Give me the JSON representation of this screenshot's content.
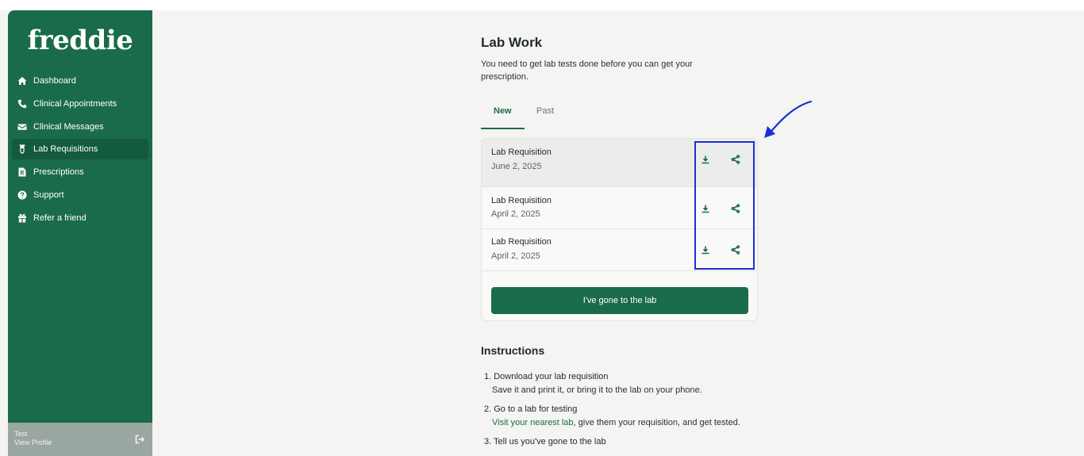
{
  "brand": {
    "logo": "freddie",
    "accent": "#1a6b4a",
    "annotation_color": "#1c2fd6"
  },
  "sidebar": {
    "items": [
      {
        "label": "Dashboard",
        "icon": "home-icon"
      },
      {
        "label": "Clinical Appointments",
        "icon": "phone-icon"
      },
      {
        "label": "Clinical Messages",
        "icon": "envelope-icon"
      },
      {
        "label": "Lab Requisitions",
        "icon": "test-tube-icon",
        "active": true
      },
      {
        "label": "Prescriptions",
        "icon": "prescription-icon"
      },
      {
        "label": "Support",
        "icon": "question-icon"
      },
      {
        "label": "Refer a friend",
        "icon": "gift-icon"
      }
    ],
    "profile": {
      "name": "Test",
      "link": "View Profile",
      "icon": "logout-icon"
    }
  },
  "main": {
    "title": "Lab Work",
    "subtitle": "You need to get lab tests done before you can get your prescription.",
    "tabs": [
      {
        "label": "New",
        "active": true
      },
      {
        "label": "Past"
      }
    ],
    "requisitions": [
      {
        "name": "Lab Requisition",
        "date": "June 2, 2025"
      },
      {
        "name": "Lab Requisition",
        "date": "April 2, 2025"
      },
      {
        "name": "Lab Requisition",
        "date": "April 2, 2025"
      }
    ],
    "button_label": "I've gone to the lab"
  },
  "instructions": {
    "title": "Instructions",
    "steps": [
      {
        "title": "1. Download your lab requisition",
        "body": "Save it and print it, or bring it to the lab on your phone."
      },
      {
        "title": "2. Go to a lab for testing",
        "link": "Visit your nearest lab",
        "body": ", give them your requisition, and get tested."
      },
      {
        "title": "3. Tell us you've gone to the lab"
      }
    ]
  }
}
